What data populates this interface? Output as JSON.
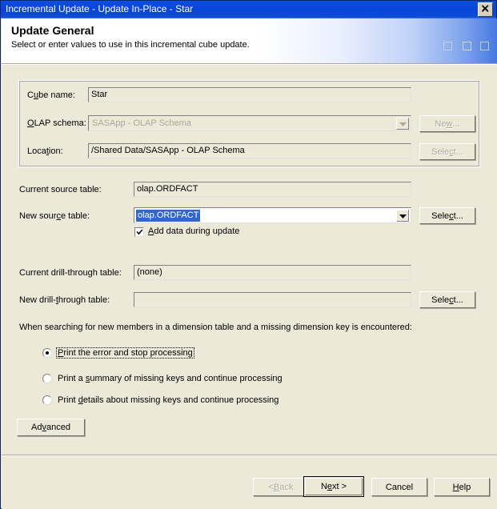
{
  "window": {
    "title": "Incremental Update - Update In-Place - Star",
    "close_label": "Close"
  },
  "header": {
    "title": "Update General",
    "subtitle": "Select or enter values to use in this incremental cube update."
  },
  "cube_group": {
    "cube_name_label": "Cube name:",
    "cube_name_mnemonic_pre": "C",
    "cube_name_mnemonic": "u",
    "cube_name_mnemonic_post": "be name:",
    "cube_name_value": "Star",
    "olap_schema_label": "OLAP schema:",
    "olap_schema_mnemonic": "O",
    "olap_schema_mnemonic_post": "LAP schema:",
    "olap_schema_value": "SASApp - OLAP Schema",
    "new_button_label": "New...",
    "new_button_pre": "Ne",
    "new_button_mn": "w",
    "new_button_post": "...",
    "location_label": "Location:",
    "location_pre": "Loca",
    "location_mn": "t",
    "location_post": "ion:",
    "location_value": "/Shared Data/SASApp - OLAP Schema",
    "location_button_label": "Select...",
    "location_button_pre": "Sele",
    "location_button_mn": "c",
    "location_button_post": "t..."
  },
  "source": {
    "current_label": "Current source table:",
    "current_value": "olap.ORDFACT",
    "new_label": "New source table:",
    "new_label_pre": "New sour",
    "new_label_mn": "c",
    "new_label_post": "e table:",
    "new_value": "olap.ORDFACT",
    "select_button_label": "Select...",
    "select_button_pre": "Sele",
    "select_button_mn": "c",
    "select_button_post": "t...",
    "checkbox_label": "Add data during update",
    "checkbox_mn": "A",
    "checkbox_post": "dd data during update",
    "checkbox_checked": true
  },
  "drillthrough": {
    "current_label": "Current drill-through table:",
    "current_value": "(none)",
    "new_label": "New drill-through table:",
    "new_label_pre": "New drill-",
    "new_label_mn": "t",
    "new_label_post": "hrough table:",
    "new_value": "",
    "select_button_label": "Select...",
    "select_button_pre": "Sele",
    "select_button_mn": "c",
    "select_button_post": "t..."
  },
  "missing_keys": {
    "prompt": "When searching for new members in a dimension table and a missing dimension key is encountered:",
    "options": [
      {
        "label": "Print the error and stop processing",
        "mn": "P",
        "post": "rint the error and stop processing",
        "pre": "",
        "selected": true,
        "focused": true
      },
      {
        "label": "Print a summary of missing keys and continue processing",
        "pre": "Print a ",
        "mn": "s",
        "post": "ummary of missing keys and continue processing",
        "selected": false,
        "focused": false
      },
      {
        "label": "Print details about missing keys and continue processing",
        "pre": "Print ",
        "mn": "d",
        "post": "etails about missing keys and continue processing",
        "selected": false,
        "focused": false
      }
    ]
  },
  "advanced": {
    "label": "Advanced",
    "pre": "Ad",
    "mn": "v",
    "post": "anced"
  },
  "footer": {
    "back_label": "< Back",
    "back_pre": "< ",
    "back_mn": "B",
    "back_post": "ack",
    "back_enabled": false,
    "next_label": "Next >",
    "next_pre": "N",
    "next_mn": "e",
    "next_post": "xt >",
    "cancel_label": "Cancel",
    "help_label": "Help",
    "help_pre": "",
    "help_mn": "H",
    "help_post": "elp"
  },
  "colors": {
    "titlebar_blue": "#0A4ACE",
    "dialog_face": "#ECE9D8",
    "selection_blue": "#3167C7",
    "disabled_text": "#ACA899"
  }
}
